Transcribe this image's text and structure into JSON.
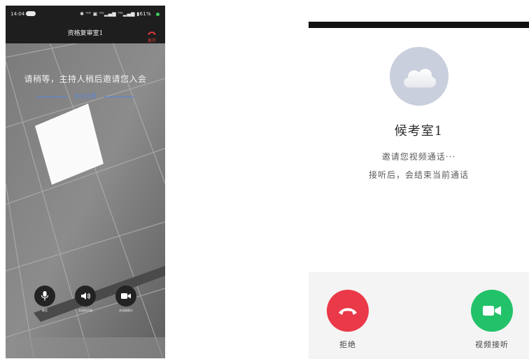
{
  "left_screen": {
    "status_bar": {
      "time": "14:04",
      "indicators": "✱ ᴴᴰ ▣ ⁵ᴳ▂▄▆ ᴴᴰ▂▄▆ ▮61%",
      "battery": "61%"
    },
    "room_title": "资格复审室1",
    "leave_label": "离开",
    "wait_message": "请稍等，主持人稍后邀请您入会",
    "meeting_topic": "会议主题",
    "controls": [
      {
        "label": "静音",
        "icon": "microphone-icon"
      },
      {
        "label": "关闭扬声器",
        "icon": "speaker-icon"
      },
      {
        "label": "关闭摄像头",
        "icon": "camera-icon"
      }
    ]
  },
  "right_screen": {
    "avatar_icon": "cloud-icon",
    "caller_name": "候考室1",
    "invite_message": "邀请您视频通话···",
    "notice_message": "接听后，会结束当前通话",
    "actions": {
      "decline": {
        "label": "拒绝",
        "color": "#ea3948",
        "icon": "hang-up-icon"
      },
      "accept": {
        "label": "视频接听",
        "color": "#22c269",
        "icon": "video-camera-icon"
      }
    }
  }
}
